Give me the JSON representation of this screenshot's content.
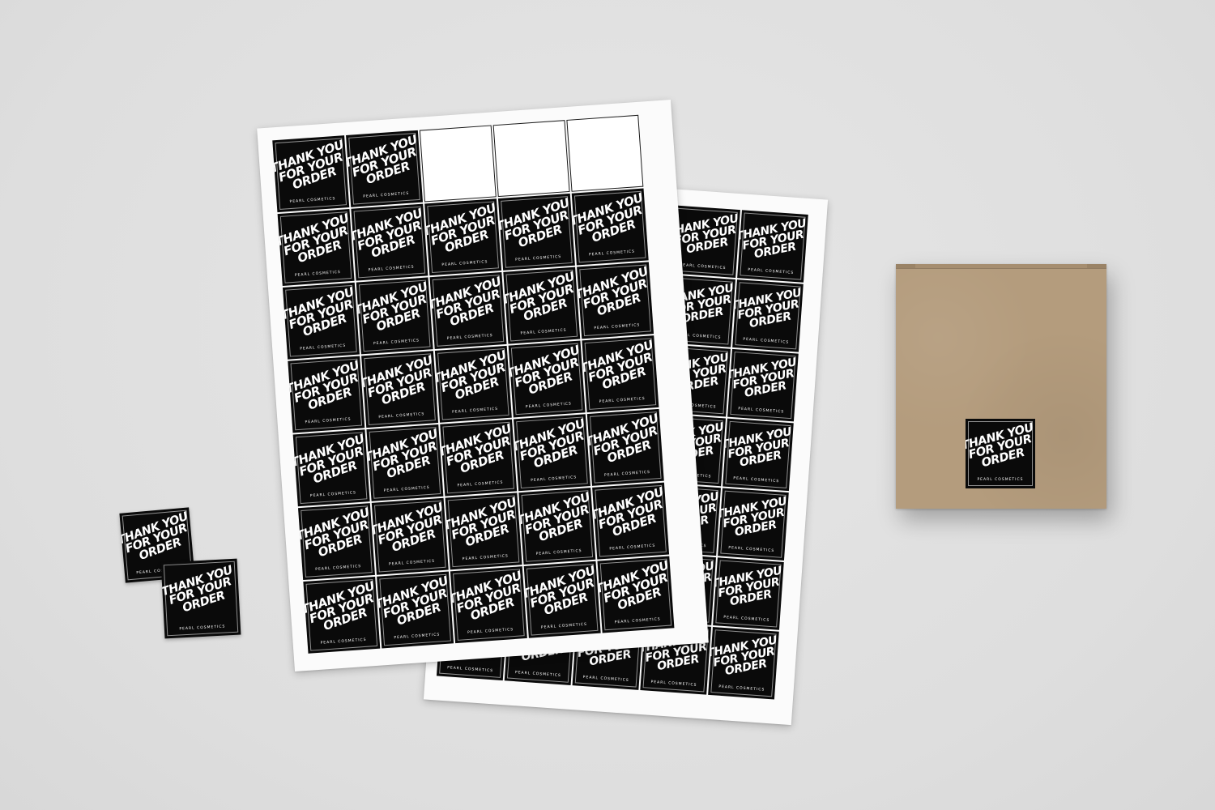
{
  "sticker": {
    "line1": "THANK YOU",
    "line2": "FOR YOUR",
    "line3": "ORDER",
    "brand": "PEARL COSMETICS"
  },
  "scene": {
    "background_color": "#e1e1e1",
    "sticker_color": "#0a0a0a",
    "sticker_text_color": "#ffffff",
    "kraft_box_color": "#b49c7d"
  },
  "front_sheet": {
    "rows": 7,
    "columns": 5,
    "peeled_slots": [
      2,
      3,
      4
    ]
  },
  "back_sheet": {
    "rows": 7,
    "columns": 5,
    "peeled_slots": []
  },
  "loose_sticker_count": 2
}
